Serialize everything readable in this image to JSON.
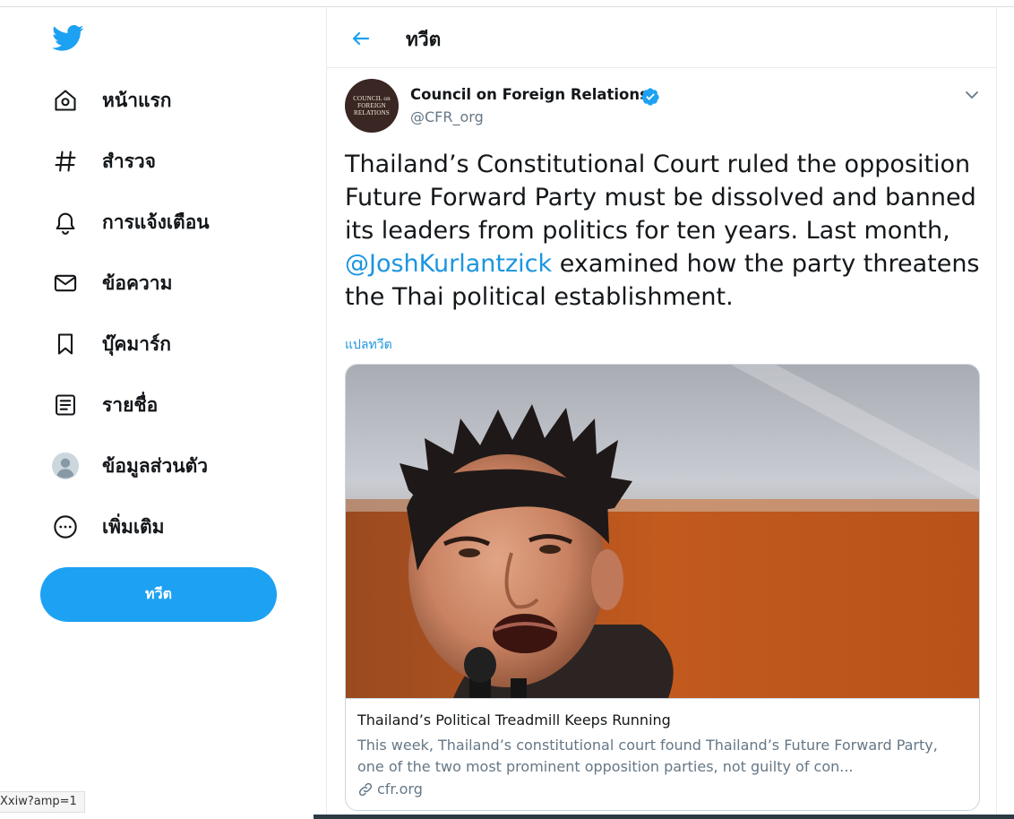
{
  "colors": {
    "brand": "#1da1f2",
    "link": "#1b95e0",
    "text": "#14171a",
    "muted": "#657786"
  },
  "sidebar": {
    "logo_icon": "twitter-bird-icon",
    "items": [
      {
        "label": "หน้าแรก",
        "icon": "home-icon"
      },
      {
        "label": "สำรวจ",
        "icon": "hashtag-icon"
      },
      {
        "label": "การแจ้งเตือน",
        "icon": "bell-icon"
      },
      {
        "label": "ข้อความ",
        "icon": "envelope-icon"
      },
      {
        "label": "บุ๊คมาร์ก",
        "icon": "bookmark-icon"
      },
      {
        "label": "รายชื่อ",
        "icon": "list-icon"
      },
      {
        "label": "ข้อมูลส่วนตัว",
        "icon": "profile-avatar-icon"
      },
      {
        "label": "เพิ่มเติม",
        "icon": "more-dots-icon"
      }
    ],
    "tweet_button": "ทวีต"
  },
  "header": {
    "title": "ทวีต",
    "back_icon": "back-arrow-icon"
  },
  "tweet": {
    "author": {
      "name": "Council on Foreign Relations",
      "handle": "@CFR_org",
      "verified": true,
      "avatar_text": [
        "COUNCIL on",
        "FOREIGN",
        "RELATIONS"
      ]
    },
    "text_before": "Thailand’s Constitutional Court ruled the opposition Future Forward Party must be dissolved and banned its leaders from politics for ten years. Last month, ",
    "mention": "@JoshKurlantzick",
    "text_after": " examined how the party threatens the Thai political establishment.",
    "translate": "แปลทวีต",
    "card": {
      "title": "Thailand’s Political Treadmill Keeps Running",
      "description": "This week, Thailand’s constitutional court found Thailand’s Future Forward Party, one of the two most prominent opposition parties, not guilty of con...",
      "domain": "cfr.org"
    }
  },
  "status_bar": {
    "url": "Xxiw?amp=1"
  }
}
